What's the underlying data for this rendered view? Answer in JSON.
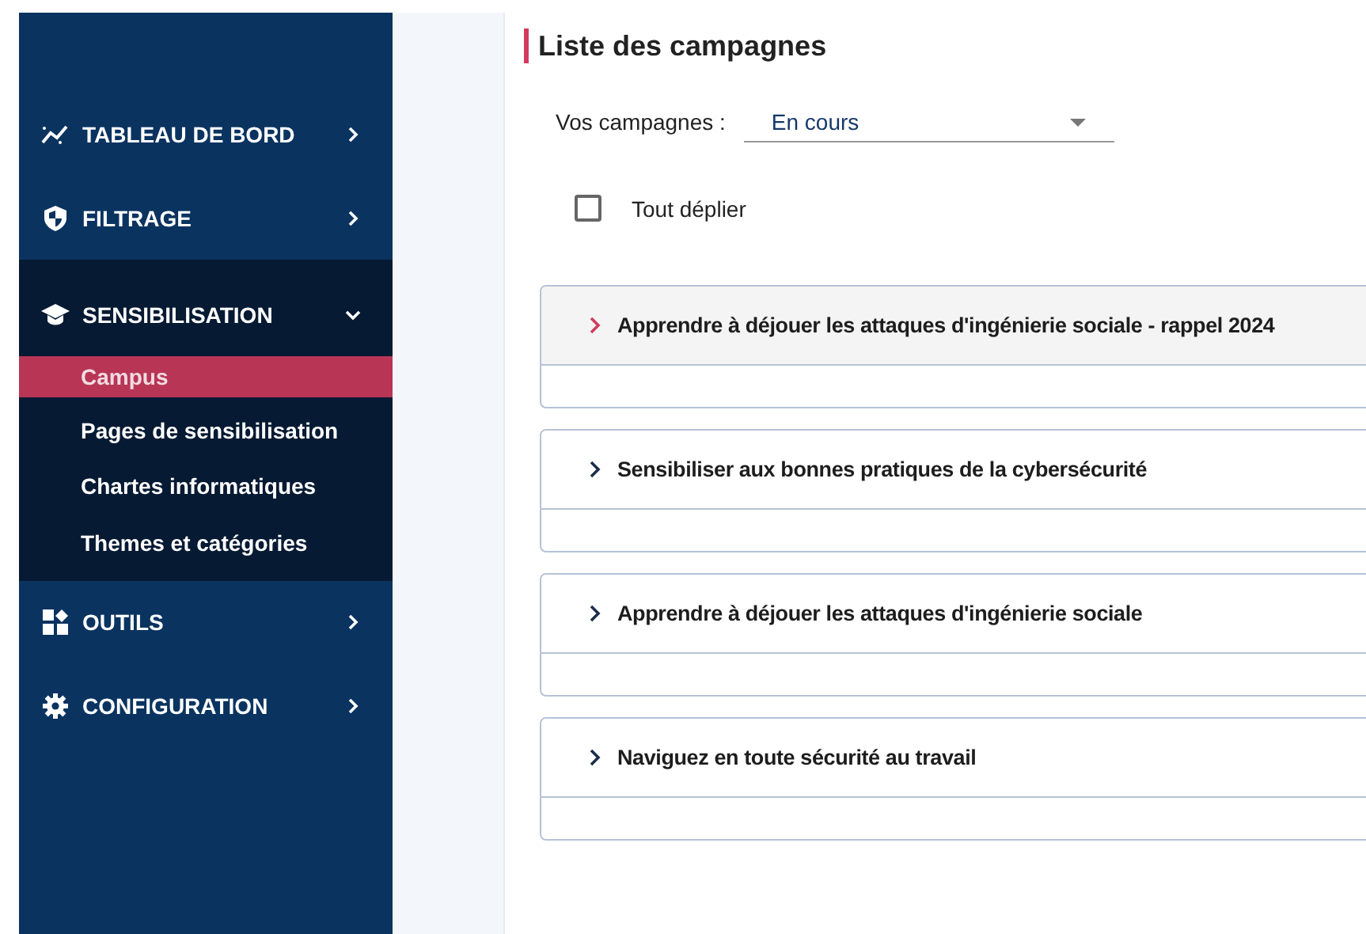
{
  "sidebar": {
    "items": [
      {
        "label": "TABLEAU DE BORD",
        "expanded": false
      },
      {
        "label": "FILTRAGE",
        "expanded": false
      },
      {
        "label": "SENSIBILISATION",
        "expanded": true,
        "children": [
          {
            "label": "Campus",
            "selected": true
          },
          {
            "label": "Pages de sensibilisation",
            "selected": false
          },
          {
            "label": "Chartes informatiques",
            "selected": false
          },
          {
            "label": "Themes et catégories",
            "selected": false
          }
        ]
      },
      {
        "label": "OUTILS",
        "expanded": false
      },
      {
        "label": "CONFIGURATION",
        "expanded": false
      }
    ]
  },
  "page": {
    "title": "Liste des campagnes",
    "filter": {
      "label": "Vos campagnes :",
      "value": "En cours"
    },
    "expand_all": {
      "label": "Tout déplier",
      "checked": false
    },
    "campaigns": [
      {
        "title": "Apprendre à déjouer les attaques d'ingénierie sociale - rappel 2024",
        "selected": true
      },
      {
        "title": "Sensibiliser aux bonnes pratiques de la cybersécurité",
        "selected": false
      },
      {
        "title": "Apprendre à déjouer les attaques d'ingénierie sociale",
        "selected": false
      },
      {
        "title": "Naviguez en toute sécurité au travail",
        "selected": false
      }
    ]
  }
}
